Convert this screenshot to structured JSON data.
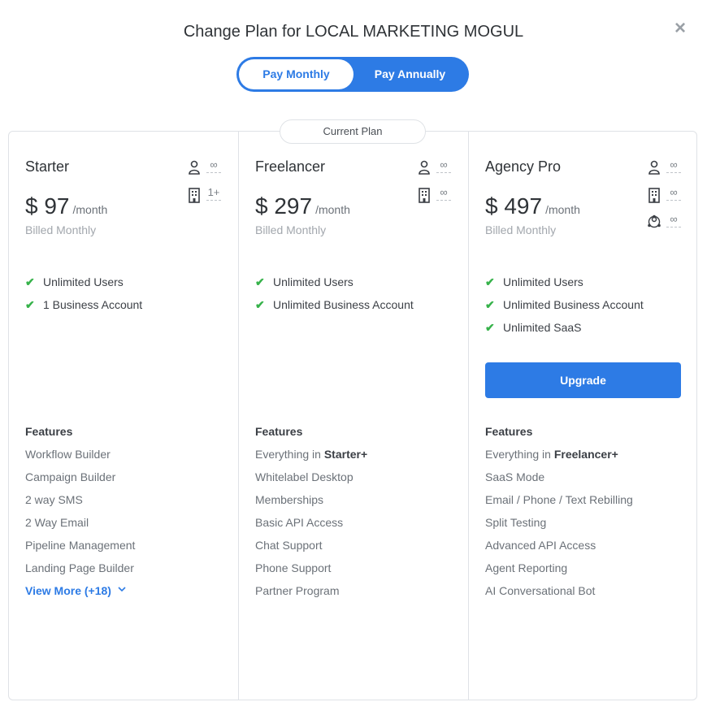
{
  "modal": {
    "title": "Change Plan for LOCAL MARKETING MOGUL",
    "close_icon": "×"
  },
  "billing_toggle": {
    "monthly": "Pay Monthly",
    "annually": "Pay Annually",
    "selected": "Pay Monthly"
  },
  "current_plan_label": "Current Plan",
  "plans": [
    {
      "name": "Starter",
      "price": "$ 97",
      "period": "/month",
      "billed": "Billed Monthly",
      "limits": {
        "users": "∞",
        "accounts": "1+"
      },
      "included": [
        "Unlimited Users",
        "1 Business Account"
      ],
      "features_heading": "Features",
      "features": [
        "Workflow Builder",
        "Campaign Builder",
        "2 way SMS",
        "2 Way Email",
        "Pipeline Management",
        "Landing Page Builder"
      ],
      "view_more": "View More (+18)"
    },
    {
      "name": "Freelancer",
      "price": "$ 297",
      "period": "/month",
      "billed": "Billed Monthly",
      "limits": {
        "users": "∞",
        "accounts": "∞"
      },
      "included": [
        "Unlimited Users",
        "Unlimited Business Account"
      ],
      "features_heading": "Features",
      "features_prefix": "Everything in ",
      "features_prefix_bold": "Starter+",
      "features": [
        "Whitelabel Desktop",
        "Memberships",
        "Basic API Access",
        "Chat Support",
        "Phone Support",
        "Partner Program"
      ]
    },
    {
      "name": "Agency Pro",
      "price": "$ 497",
      "period": "/month",
      "billed": "Billed Monthly",
      "limits": {
        "users": "∞",
        "accounts": "∞",
        "saas": "∞"
      },
      "included": [
        "Unlimited Users",
        "Unlimited Business Account",
        "Unlimited SaaS"
      ],
      "upgrade_label": "Upgrade",
      "features_heading": "Features",
      "features_prefix": "Everything in ",
      "features_prefix_bold": "Freelancer+",
      "features": [
        "SaaS Mode",
        "Email / Phone / Text Rebilling",
        "Split Testing",
        "Advanced API Access",
        "Agent Reporting",
        "AI Conversational Bot"
      ]
    }
  ],
  "colors": {
    "accent": "#2d7be5",
    "check": "#36b24a"
  }
}
